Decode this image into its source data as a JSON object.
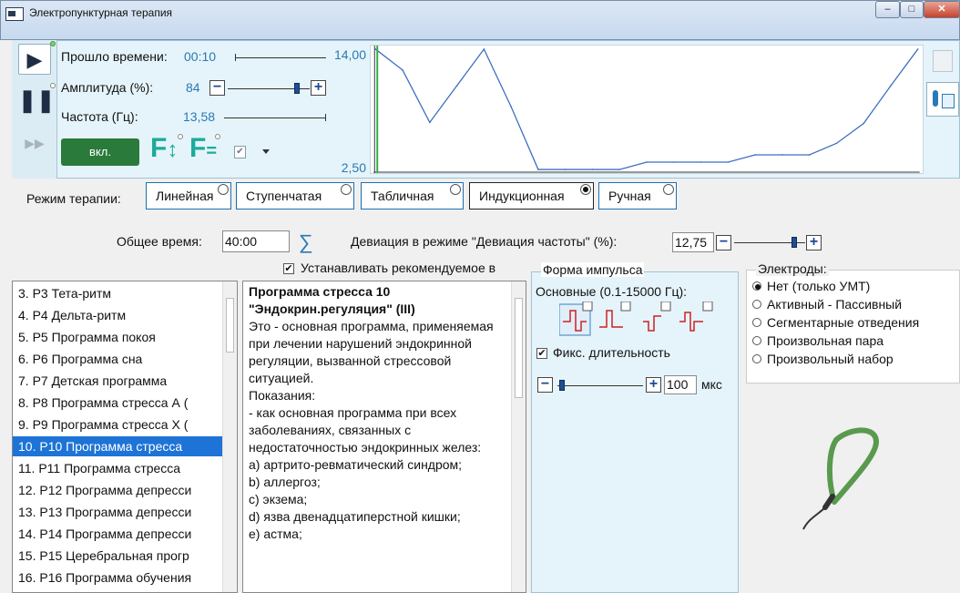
{
  "window": {
    "title": "Электропунктурная терапия",
    "min": "‒",
    "max": "□",
    "close": "✕"
  },
  "playback": {
    "play": "▶",
    "pause": "❚❚",
    "ff": "▶▶"
  },
  "params": {
    "elapsed_label": "Прошло времени:",
    "elapsed_value": "00:10",
    "amp_label": "Амплитуда (%):",
    "amp_value": "84",
    "amp_level": 0.84,
    "freq_label": "Частота (Гц):",
    "freq_value": "13,58",
    "minus": "−",
    "plus": "+"
  },
  "on_button": "вкл.",
  "f_buttons": {
    "f_arrow": "F",
    "arrow": "↕",
    "f_eq": "F",
    "eq": "="
  },
  "chart_data": {
    "type": "line",
    "ylim": [
      2.5,
      14.0
    ],
    "ytick_labels": [
      "14,00",
      "2,50"
    ],
    "x": [
      0,
      1,
      2,
      3,
      4,
      5,
      6,
      7,
      8,
      9,
      10,
      11,
      12,
      13,
      14,
      15,
      16,
      17,
      18,
      19,
      20
    ],
    "values": [
      14.0,
      12.0,
      7.0,
      10.5,
      14.0,
      8.5,
      2.5,
      2.5,
      2.5,
      2.5,
      3.2,
      3.2,
      3.2,
      3.2,
      3.9,
      3.9,
      3.9,
      5.0,
      6.9,
      10.5,
      14.0
    ],
    "marker_x": 0,
    "colors": {
      "line": "#3d6fc0",
      "marker": "#2db04a"
    }
  },
  "mode": {
    "label": "Режим терапии:",
    "options": [
      {
        "label": "Линейная",
        "selected": false
      },
      {
        "label": "Ступенчатая",
        "selected": false
      },
      {
        "label": "Табличная",
        "selected": false
      },
      {
        "label": "Индукционная",
        "selected": true
      },
      {
        "label": "Ручная",
        "selected": false
      }
    ]
  },
  "total": {
    "label": "Общее время:",
    "value": "40:00",
    "sum_icon": "∑"
  },
  "deviation": {
    "label": "Девиация в режиме \"Девиация частоты\" (%):",
    "value": "12,75",
    "level": 0.85
  },
  "recommended": {
    "label": "Устанавливать рекомендуемое в",
    "checked": true
  },
  "programs": [
    {
      "label": "3. Р3 Тета-ритм",
      "selected": false
    },
    {
      "label": "4. Р4 Дельта-ритм",
      "selected": false
    },
    {
      "label": "5. Р5 Программа покоя",
      "selected": false
    },
    {
      "label": "6. Р6 Программа сна",
      "selected": false
    },
    {
      "label": "7. Р7 Детская программа",
      "selected": false
    },
    {
      "label": "8. Р8 Программа стресса А (",
      "selected": false
    },
    {
      "label": "9. Р9 Программа стресса Х (",
      "selected": false
    },
    {
      "label": "10. Р10 Программа стресса",
      "selected": true
    },
    {
      "label": "11. Р11 Программа стресса",
      "selected": false
    },
    {
      "label": "12. Р12 Программа депресси",
      "selected": false
    },
    {
      "label": "13. Р13 Программа депресси",
      "selected": false
    },
    {
      "label": "14. Р14 Программа депресси",
      "selected": false
    },
    {
      "label": "15. Р15 Церебральная прогр",
      "selected": false
    },
    {
      "label": "16. Р16 Программа обучения",
      "selected": false
    }
  ],
  "description": {
    "title": "Программа стресса 10 \"Эндокрин.регуляция\" (III)",
    "body": "Это - основная программа, применяемая при лечении нарушений эндокринной регуляции, вызванной стрессовой ситуацией.\nПоказания:\n- как основная программа при всех заболеваниях, связанных с недостаточностью эндокринных желез:\nа) артрито-ревматический синдром;\nb) аллергоз;\nс) экзема;\nd) язва двенадцатиперстной кишки;\ne) астма;"
  },
  "pulse": {
    "title": "Форма импульса",
    "basic_label": "Основные (0.1-15000 Гц):",
    "fixed_label": "Фикс. длительность",
    "fixed_checked": true,
    "duration_value": "100",
    "duration_unit": "мкс",
    "duration_level": 0.05
  },
  "electrodes": {
    "title": "Электроды:",
    "options": [
      {
        "label": "Нет (только УМТ)",
        "selected": true
      },
      {
        "label": "Активный - Пассивный",
        "selected": false
      },
      {
        "label": "Сегментарные отведения",
        "selected": false
      },
      {
        "label": "Произвольная пара",
        "selected": false
      },
      {
        "label": "Произвольный набор",
        "selected": false
      }
    ]
  },
  "check_mark": "✔"
}
